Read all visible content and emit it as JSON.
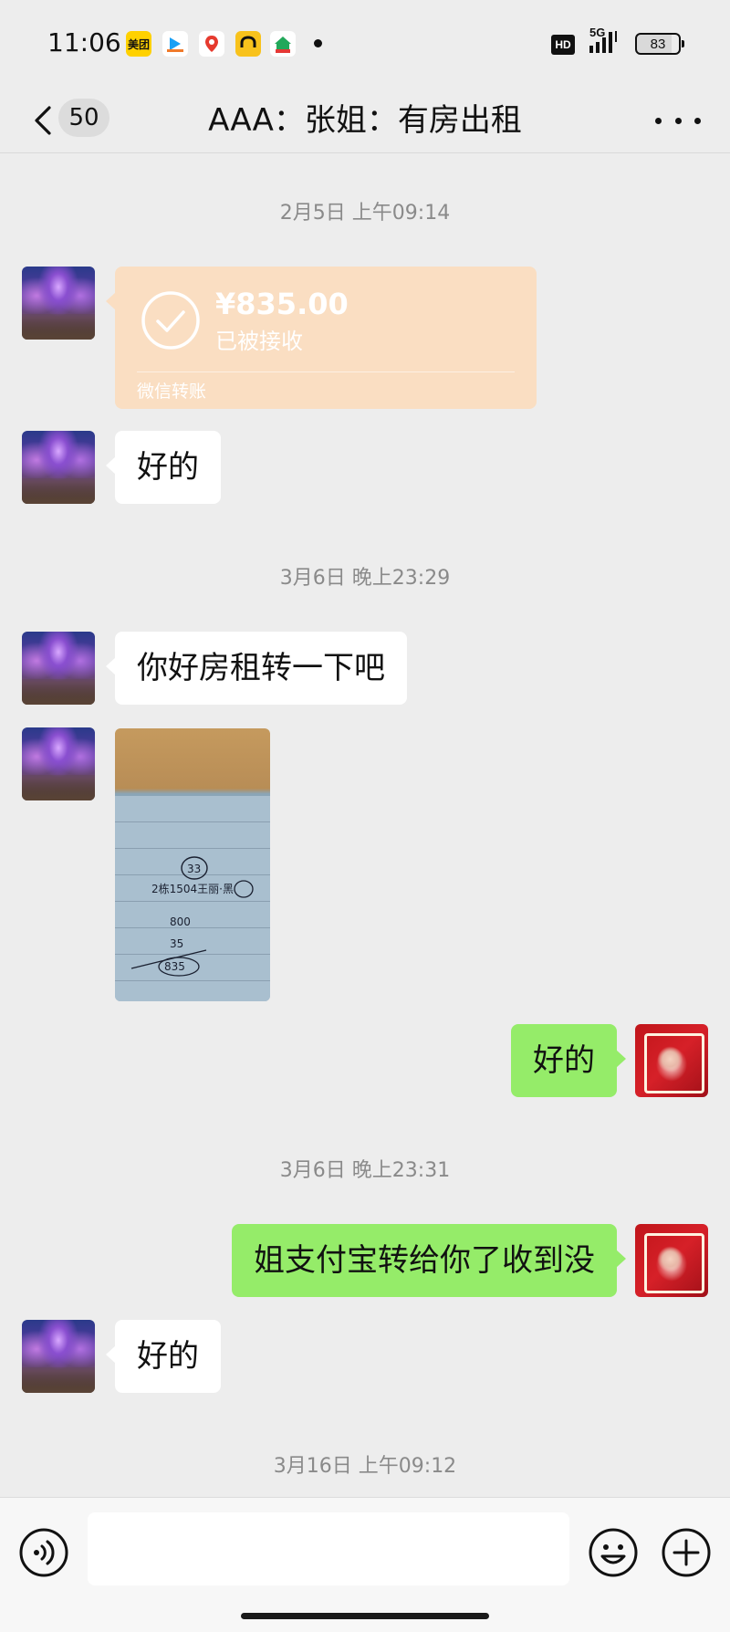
{
  "status_bar": {
    "time": "11:06",
    "apps": [
      {
        "icon": "meituan-icon",
        "label": "美团",
        "color": "#ffd100"
      },
      {
        "icon": "video-app-icon",
        "label": "",
        "color": "#ffffff"
      },
      {
        "icon": "map-pin-app-icon",
        "label": "",
        "color": "#ffffff"
      },
      {
        "icon": "car-app-icon",
        "label": "",
        "color": "#f8c21c"
      },
      {
        "icon": "home-app-icon",
        "label": "",
        "color": "#ffffff"
      }
    ],
    "hd": "HD",
    "network": "5G",
    "battery": "83"
  },
  "nav": {
    "unread_count": "50",
    "title": "AAA：张姐：有房出租"
  },
  "messages": {
    "ts1": "2月5日 上午09:14",
    "transfer": {
      "amount": "¥835.00",
      "status": "已被接收",
      "source": "微信转账"
    },
    "m1": "好的",
    "ts2": "3月6日 晚上23:29",
    "m2": "你好房租转一下吧",
    "photo": {
      "lines": [
        "33",
        "2栋1504王丽·黑",
        "800",
        "35",
        "835"
      ]
    },
    "m3": "好的",
    "ts3": "3月6日 晚上23:31",
    "m4": "姐支付宝转给你了收到没",
    "m5": "好的",
    "ts4": "3月16日 上午09:12"
  },
  "input": {
    "placeholder": ""
  },
  "colors": {
    "background": "#ededed",
    "outgoing_bubble": "#95ec69",
    "incoming_bubble": "#ffffff",
    "transfer_card": "#fadec2"
  }
}
